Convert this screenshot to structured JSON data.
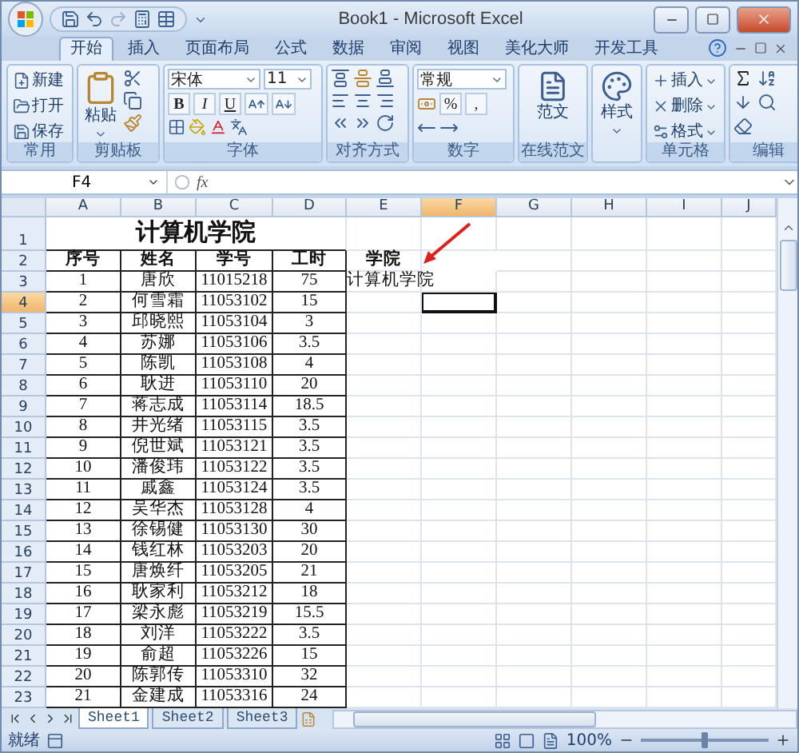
{
  "window": {
    "title": "Book1 - Microsoft Excel"
  },
  "tabs": [
    {
      "label": "开始",
      "selected": true
    },
    {
      "label": "插入",
      "selected": false
    },
    {
      "label": "页面布局",
      "selected": false
    },
    {
      "label": "公式",
      "selected": false
    },
    {
      "label": "数据",
      "selected": false
    },
    {
      "label": "审阅",
      "selected": false
    },
    {
      "label": "视图",
      "selected": false
    },
    {
      "label": "美化大师",
      "selected": false
    },
    {
      "label": "开发工具",
      "selected": false
    }
  ],
  "ribbon": [
    {
      "kind": "list",
      "label": "常用",
      "items": [
        {
          "label": "新建",
          "dropdown": false
        },
        {
          "label": "打开",
          "dropdown": false
        },
        {
          "label": "保存",
          "dropdown": false
        }
      ]
    },
    {
      "kind": "clipboard",
      "label": "剪贴板",
      "paste": "粘贴"
    },
    {
      "kind": "font",
      "label": "字体",
      "font": "宋体",
      "size": "11",
      "styles": [
        "B",
        "I",
        "U"
      ]
    },
    {
      "kind": "align",
      "label": "对齐方式"
    },
    {
      "kind": "number",
      "label": "数字",
      "format": "常规",
      "symbols": [
        "%",
        ","
      ]
    },
    {
      "kind": "big",
      "label": "在线范文",
      "button": "范文",
      "dropdown": false
    },
    {
      "kind": "big",
      "button": "样式",
      "dropdown": true
    },
    {
      "kind": "list",
      "label": "单元格",
      "items": [
        {
          "label": "插入",
          "dropdown": true
        },
        {
          "label": "删除",
          "dropdown": true
        },
        {
          "label": "格式",
          "dropdown": true
        }
      ]
    },
    {
      "kind": "edit",
      "label": "编辑"
    }
  ],
  "formula_bar": {
    "name_box": "F4",
    "function_label": "fx"
  },
  "sheet": {
    "columns": [
      {
        "label": "A",
        "selected": false
      },
      {
        "label": "B",
        "selected": false
      },
      {
        "label": "C",
        "selected": false
      },
      {
        "label": "D",
        "selected": false
      },
      {
        "label": "E",
        "selected": false
      },
      {
        "label": "F",
        "selected": true
      },
      {
        "label": "G",
        "selected": false
      },
      {
        "label": "H",
        "selected": false
      },
      {
        "label": "I",
        "selected": false
      },
      {
        "label": "J",
        "selected": false
      }
    ],
    "rows": [
      {
        "number": "1",
        "kind": "title",
        "selected": false,
        "title": "计算机学院"
      },
      {
        "number": "2",
        "kind": "header",
        "selected": false,
        "cells": [
          "序号",
          "姓名",
          "学号",
          "工时"
        ],
        "note": "学院"
      },
      {
        "number": "3",
        "kind": "data",
        "selected": false,
        "cells": [
          "1",
          "唐欣",
          "11015218",
          "75"
        ],
        "note": "计算机学院"
      },
      {
        "number": "4",
        "kind": "data",
        "selected": true,
        "cells": [
          "2",
          "何雪霜",
          "11053102",
          "15"
        ]
      },
      {
        "number": "5",
        "kind": "data",
        "selected": false,
        "cells": [
          "3",
          "邱晓熙",
          "11053104",
          "3"
        ]
      },
      {
        "number": "6",
        "kind": "data",
        "selected": false,
        "cells": [
          "4",
          "苏娜",
          "11053106",
          "3.5"
        ]
      },
      {
        "number": "7",
        "kind": "data",
        "selected": false,
        "cells": [
          "5",
          "陈凯",
          "11053108",
          "4"
        ]
      },
      {
        "number": "8",
        "kind": "data",
        "selected": false,
        "cells": [
          "6",
          "耿进",
          "11053110",
          "20"
        ]
      },
      {
        "number": "9",
        "kind": "data",
        "selected": false,
        "cells": [
          "7",
          "蒋志成",
          "11053114",
          "18.5"
        ]
      },
      {
        "number": "10",
        "kind": "data",
        "selected": false,
        "cells": [
          "8",
          "井光绪",
          "11053115",
          "3.5"
        ]
      },
      {
        "number": "11",
        "kind": "data",
        "selected": false,
        "cells": [
          "9",
          "倪世斌",
          "11053121",
          "3.5"
        ]
      },
      {
        "number": "12",
        "kind": "data",
        "selected": false,
        "cells": [
          "10",
          "潘俊玮",
          "11053122",
          "3.5"
        ]
      },
      {
        "number": "13",
        "kind": "data",
        "selected": false,
        "cells": [
          "11",
          "戚鑫",
          "11053124",
          "3.5"
        ]
      },
      {
        "number": "14",
        "kind": "data",
        "selected": false,
        "cells": [
          "12",
          "吴华杰",
          "11053128",
          "4"
        ]
      },
      {
        "number": "15",
        "kind": "data",
        "selected": false,
        "cells": [
          "13",
          "徐锡健",
          "11053130",
          "30"
        ]
      },
      {
        "number": "16",
        "kind": "data",
        "selected": false,
        "cells": [
          "14",
          "钱红林",
          "11053203",
          "20"
        ]
      },
      {
        "number": "17",
        "kind": "data",
        "selected": false,
        "cells": [
          "15",
          "唐焕纤",
          "11053205",
          "21"
        ]
      },
      {
        "number": "18",
        "kind": "data",
        "selected": false,
        "cells": [
          "16",
          "耿家利",
          "11053212",
          "18"
        ]
      },
      {
        "number": "19",
        "kind": "data",
        "selected": false,
        "cells": [
          "17",
          "梁永彪",
          "11053219",
          "15.5"
        ]
      },
      {
        "number": "20",
        "kind": "data",
        "selected": false,
        "cells": [
          "18",
          "刘洋",
          "11053222",
          "3.5"
        ]
      },
      {
        "number": "21",
        "kind": "data",
        "selected": false,
        "cells": [
          "19",
          "俞超",
          "11053226",
          "15"
        ]
      },
      {
        "number": "22",
        "kind": "data",
        "selected": false,
        "cells": [
          "20",
          "陈郭传",
          "11053310",
          "32"
        ]
      },
      {
        "number": "23",
        "kind": "data",
        "selected": false,
        "cells": [
          "21",
          "金建成",
          "11053316",
          "24"
        ]
      }
    ]
  },
  "sheet_tabs": [
    {
      "label": "Sheet1",
      "selected": true
    },
    {
      "label": "Sheet2",
      "selected": false
    },
    {
      "label": "Sheet3",
      "selected": false
    }
  ],
  "status_bar": {
    "status": "就绪",
    "zoom": {
      "reading": "100%",
      "level": 0.5
    }
  }
}
